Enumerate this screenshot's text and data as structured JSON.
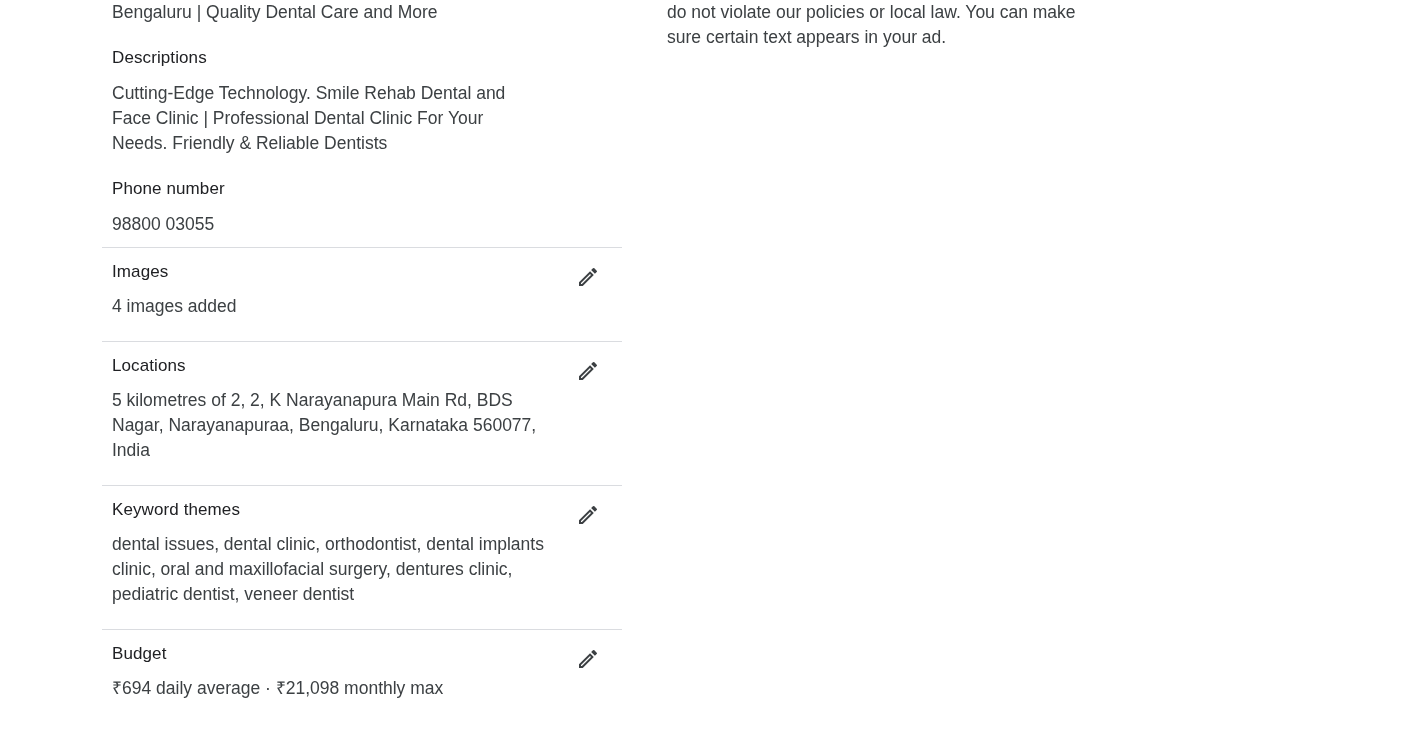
{
  "ad_summary": {
    "headline_tail": "Bengaluru | Quality Dental Care and More",
    "fields": [
      {
        "label": "Descriptions",
        "value": "Cutting-Edge Technology. Smile Rehab Dental and Face Clinic | Professional Dental Clinic For Your Needs. Friendly & Reliable Dentists"
      },
      {
        "label": "Phone number",
        "value": "98800 03055"
      }
    ]
  },
  "sections": [
    {
      "title": "Images",
      "value": "4 images added"
    },
    {
      "title": "Locations",
      "value": "5 kilometres of 2, 2, K Narayanapura Main Rd, BDS Nagar, Narayanapuraa, Bengaluru, Karnataka 560077, India"
    },
    {
      "title": "Keyword themes",
      "value": "dental issues, dental clinic, orthodontist, dental implants clinic, oral and maxillofacial surgery, dentures clinic, pediatric dentist, veneer dentist"
    },
    {
      "title": "Budget",
      "value": "₹694 daily average · ₹21,098 monthly max"
    }
  ],
  "side_note": "do not violate our policies or local law. You can make sure certain text appears in your ad."
}
